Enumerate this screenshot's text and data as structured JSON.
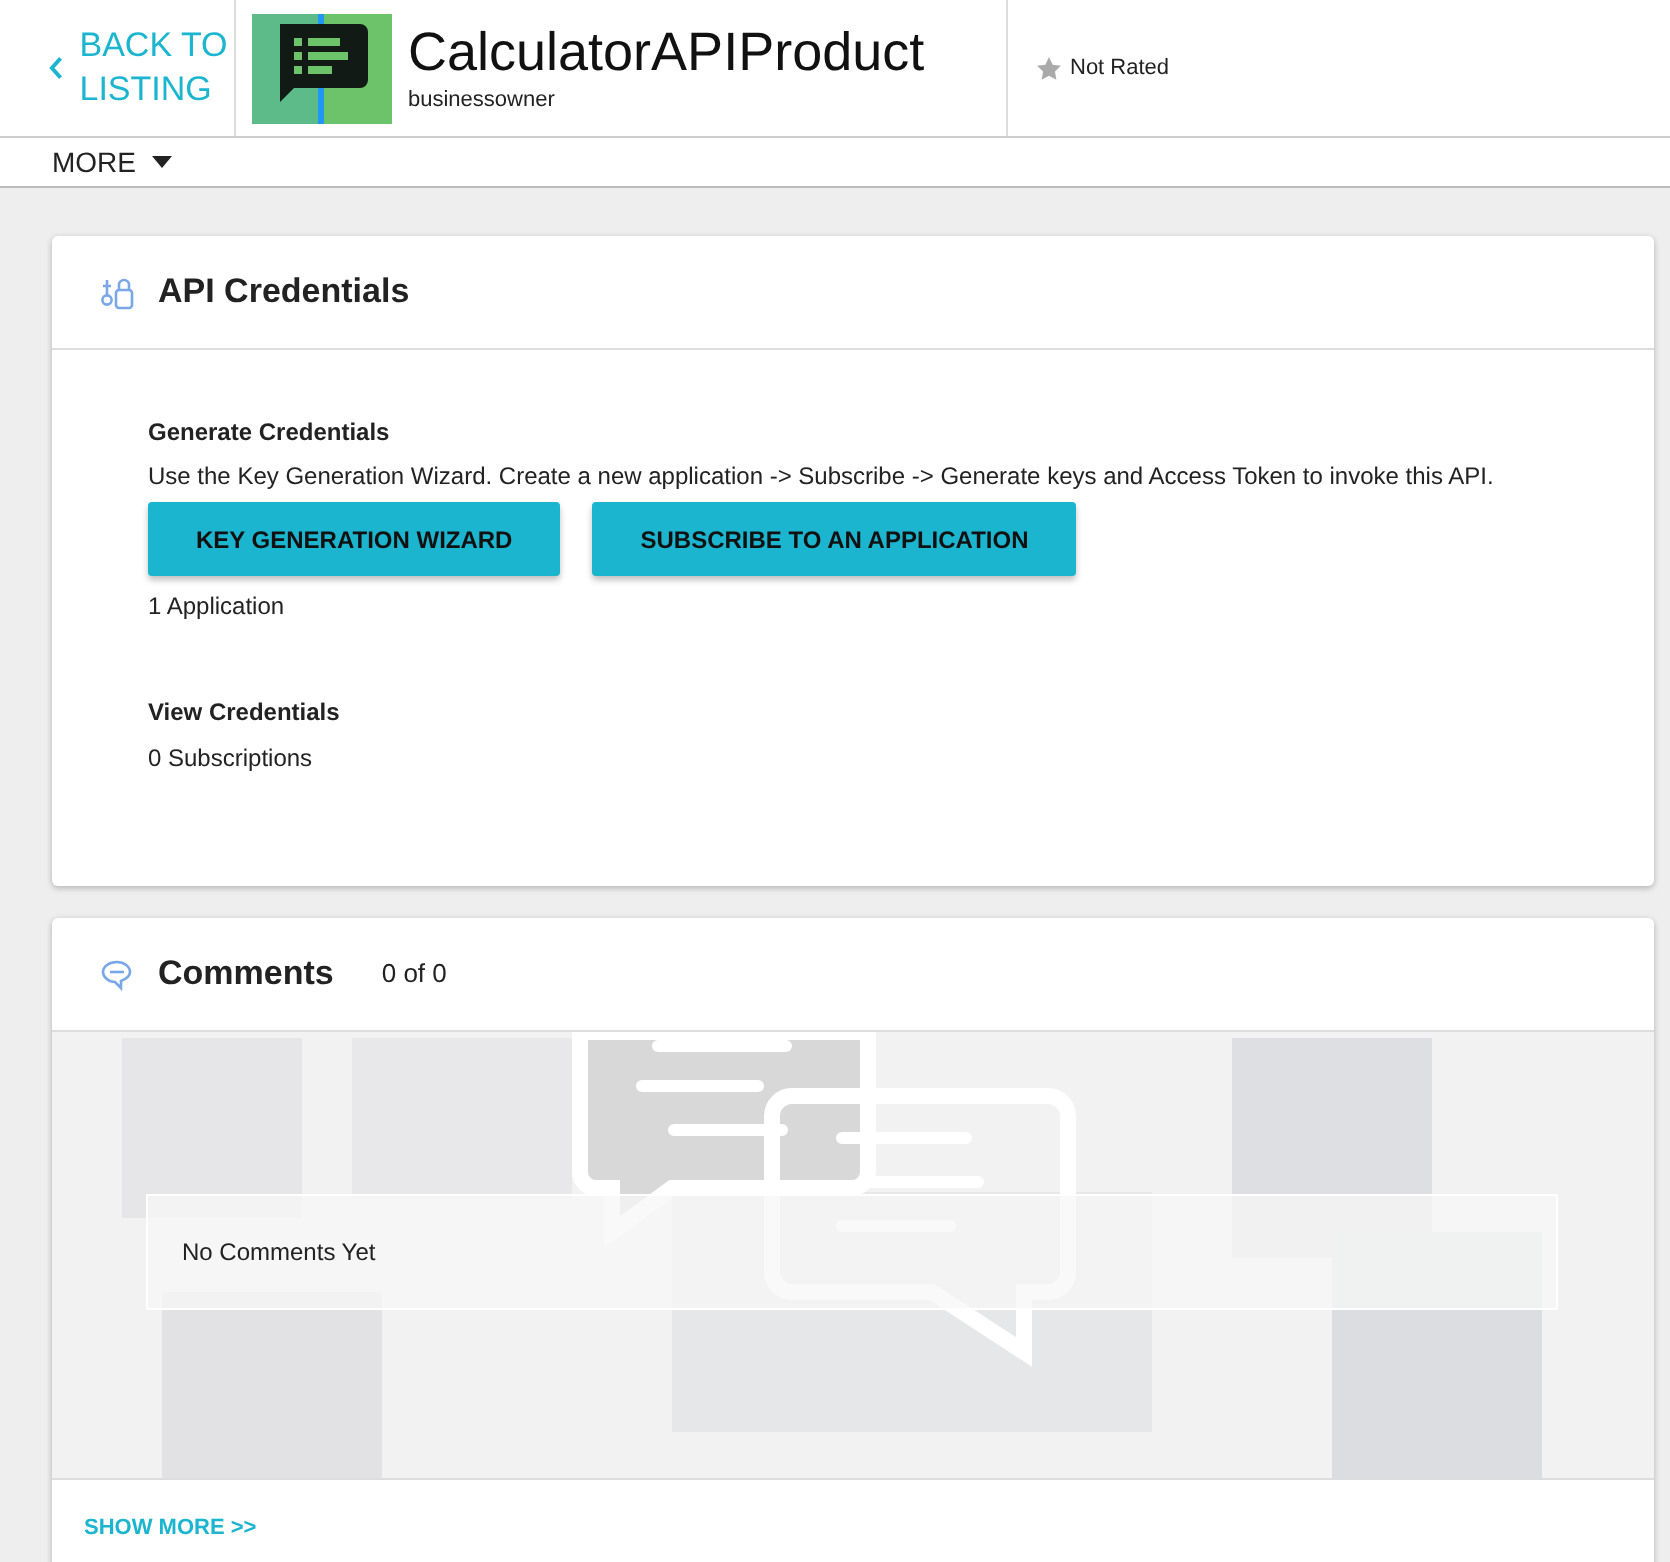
{
  "header": {
    "back_link": "BACK TO LISTING",
    "title": "CalculatorAPIProduct",
    "owner": "businessowner",
    "rating": {
      "label": "Not Rated"
    }
  },
  "menu": {
    "label": "MORE"
  },
  "credentials": {
    "title": "API Credentials",
    "generate": {
      "heading": "Generate Credentials",
      "description": "Use the Key Generation Wizard. Create a new application -> Subscribe -> Generate keys and Access Token to invoke this API.",
      "buttons": [
        "KEY GENERATION WIZARD",
        "SUBSCRIBE TO AN APPLICATION"
      ],
      "count": "1 Application"
    },
    "view": {
      "heading": "View Credentials",
      "count": "0 Subscriptions"
    }
  },
  "comments": {
    "title": "Comments",
    "count": "0 of 0",
    "empty_message": "No Comments Yet",
    "show_more": "SHOW MORE >>"
  }
}
